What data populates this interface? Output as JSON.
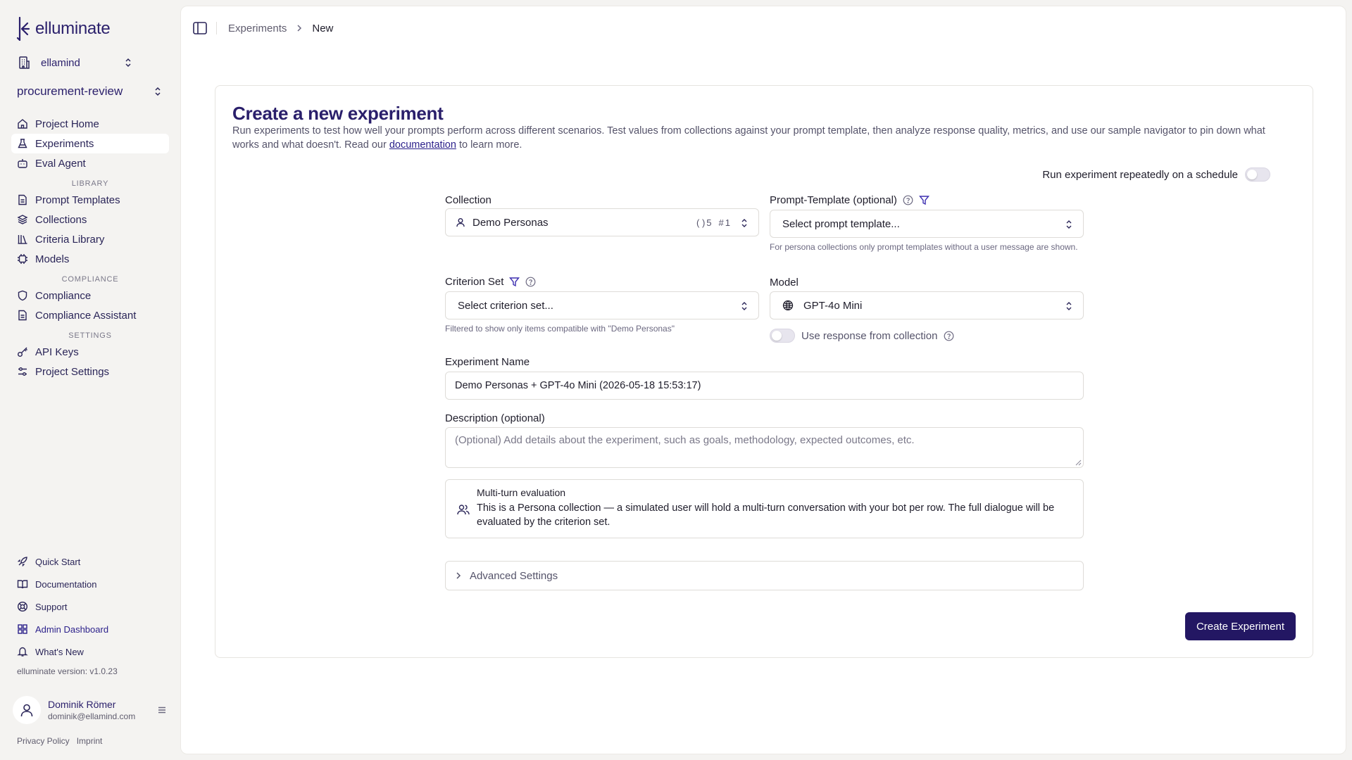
{
  "brand": {
    "name": "elluminate",
    "accent": "#2a1f6b",
    "primary_button": "#231763"
  },
  "sidebar": {
    "org": "ellamind",
    "project": "procurement-review",
    "nav": [
      {
        "label": "Project Home",
        "icon": "home-icon"
      },
      {
        "label": "Experiments",
        "icon": "flask-icon",
        "active": true
      },
      {
        "label": "Eval Agent",
        "icon": "robot-icon"
      }
    ],
    "library_title": "LIBRARY",
    "library": [
      {
        "label": "Prompt Templates",
        "icon": "file-icon"
      },
      {
        "label": "Collections",
        "icon": "stack-icon"
      },
      {
        "label": "Criteria Library",
        "icon": "library-icon"
      },
      {
        "label": "Models",
        "icon": "chip-icon"
      }
    ],
    "compliance_title": "COMPLIANCE",
    "compliance": [
      {
        "label": "Compliance",
        "icon": "shield-icon"
      },
      {
        "label": "Compliance Assistant",
        "icon": "file-icon"
      }
    ],
    "settings_title": "SETTINGS",
    "settings": [
      {
        "label": "API Keys",
        "icon": "key-icon"
      },
      {
        "label": "Project Settings",
        "icon": "sliders-icon"
      }
    ],
    "bottom": [
      {
        "label": "Quick Start",
        "icon": "rocket-icon"
      },
      {
        "label": "Documentation",
        "icon": "book-icon"
      },
      {
        "label": "Support",
        "icon": "lifebuoy-icon"
      },
      {
        "label": "Admin Dashboard",
        "icon": "dashboard-icon"
      },
      {
        "label": "What's New",
        "icon": "bell-icon"
      }
    ],
    "version": "elluminate version: v1.0.23",
    "user": {
      "name": "Dominik Römer",
      "email": "dominik@ellamind.com"
    },
    "footer": {
      "privacy": "Privacy Policy",
      "imprint": "Imprint"
    }
  },
  "breadcrumb": {
    "parent": "Experiments",
    "current": "New"
  },
  "page": {
    "title": "Create a new experiment",
    "desc_before": "Run experiments to test how well your prompts perform across different scenarios. Test values from collections against your prompt template, then analyze response quality, metrics, and use our sample navigator to pin down what works and what doesn't. Read our ",
    "desc_link": "documentation",
    "desc_after": " to learn more."
  },
  "form": {
    "schedule_label": "Run experiment repeatedly on a schedule",
    "collection": {
      "label": "Collection",
      "value": "Demo Personas",
      "columns_count": "5",
      "rows_count": "1"
    },
    "prompt_template": {
      "label": "Prompt-Template (optional)",
      "placeholder": "Select prompt template...",
      "hint": "For persona collections only prompt templates without a user message are shown."
    },
    "criterion_set": {
      "label": "Criterion Set",
      "placeholder": "Select criterion set...",
      "hint": "Filtered to show only items compatible with \"Demo Personas\""
    },
    "model": {
      "label": "Model",
      "value": "GPT-4o Mini",
      "use_response_label": "Use response from collection"
    },
    "experiment_name": {
      "label": "Experiment Name",
      "value": "Demo Personas + GPT-4o Mini (2026-05-18 15:53:17)"
    },
    "description": {
      "label": "Description (optional)",
      "placeholder": "(Optional) Add details about the experiment, such as goals, methodology, expected outcomes, etc."
    },
    "multi_turn": {
      "title": "Multi-turn evaluation",
      "text": "This is a Persona collection — a simulated user will hold a multi-turn conversation with your bot per row. The full dialogue will be evaluated by the criterion set."
    },
    "advanced_label": "Advanced Settings",
    "submit_label": "Create Experiment"
  }
}
